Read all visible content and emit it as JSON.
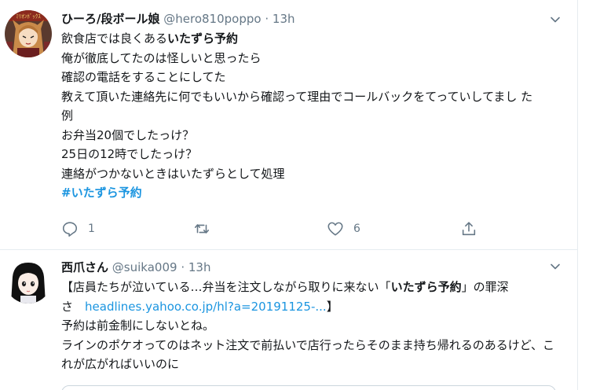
{
  "tweets": [
    {
      "display_name": "ひーろ/段ボール娘",
      "handle": "@hero810poppo",
      "separator": "·",
      "time": "13h",
      "lines": [
        {
          "pre": "飲食店では良くある",
          "bold": "いたずら予約"
        },
        {
          "text": "俺が徹底してたのは怪しいと思ったら"
        },
        {
          "text": "確認の電話をすることにしてた"
        },
        {
          "text": "教えて頂いた連絡先に何でもいいから確認って理由でコールバックをてっていしてまし た"
        },
        {
          "text": "例"
        },
        {
          "text": "お弁当20個でしたっけ？"
        },
        {
          "text": "25日の12時でしたっけ？"
        },
        {
          "text": "連絡がつかないときはいたずらとして処理"
        }
      ],
      "hashtag": "#いたずら予約",
      "actions": {
        "reply_count": "1",
        "retweet_count": "",
        "like_count": "6"
      }
    },
    {
      "display_name": "西爪さん",
      "handle": "@suika009",
      "separator": "·",
      "time": "13h",
      "line1_pre": "【店員たちが泣いている…弁当を注文しながら取りに来ない「",
      "line1_bold": "いたずら予約",
      "line1_post": "」の罪深",
      "line2_pre": "さ　",
      "line2_link": "headlines.yahoo.co.jp/hl?a=20191125-...",
      "line2_post": "】",
      "line3": "予約は前金制にしないとね。",
      "line4": "ラインのポケオってのはネット注文で前払いで店行ったらそのまま持ち帰れるのあるけど、こ",
      "line5": "れが広がればいいのに"
    }
  ],
  "colors": {
    "text": "#14171a",
    "secondary": "#657786",
    "accent": "#1b95e0",
    "divider": "#e6ecf0"
  }
}
